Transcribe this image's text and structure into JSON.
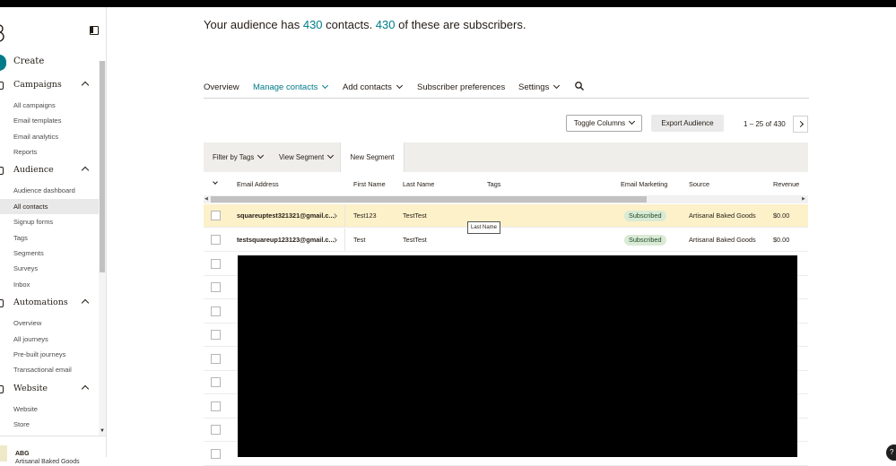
{
  "header": {
    "headline_prefix": "Your audience has ",
    "contacts_count": "430",
    "headline_middle": " contacts. ",
    "subscribers_count": "430",
    "headline_suffix": " of these are subscribers."
  },
  "sidebar": {
    "create_label": "Create",
    "sections": [
      {
        "label": "Campaigns",
        "items": [
          "All campaigns",
          "Email templates",
          "Email analytics",
          "Reports"
        ]
      },
      {
        "label": "Audience",
        "items": [
          "Audience dashboard",
          "All contacts",
          "Signup forms",
          "Tags",
          "Segments",
          "Surveys",
          "Inbox"
        ]
      },
      {
        "label": "Automations",
        "items": [
          "Overview",
          "All journeys",
          "Pre-built journeys",
          "Transactional email"
        ]
      },
      {
        "label": "Website",
        "items": [
          "Website",
          "Store"
        ]
      }
    ],
    "active_item": "All contacts",
    "account_initials": "ABG",
    "account_name": "Artisanal Baked Goods"
  },
  "nav": {
    "tabs": [
      "Overview",
      "Manage contacts",
      "Add contacts",
      "Subscriber preferences",
      "Settings"
    ],
    "active_tab": "Manage contacts"
  },
  "toolbar": {
    "toggle_columns": "Toggle Columns",
    "export_audience": "Export Audience",
    "pager_range": "1 – 25",
    "pager_of": " of 430"
  },
  "filters": {
    "filter_by_tags": "Filter by Tags",
    "view_segment": "View Segment",
    "new_segment": "New Segment"
  },
  "table": {
    "columns": [
      "Email Address",
      "First Name",
      "Last Name",
      "Tags",
      "Email Marketing",
      "Source",
      "Revenue"
    ],
    "rows": [
      {
        "email": "squareuptest321321@gmail.c...",
        "first": "Test123",
        "last": "TestTest",
        "tags": "",
        "status": "Subscribed",
        "source": "Artisanal Baked Goods",
        "revenue": "$0.00"
      },
      {
        "email": "testsquareup123123@gmail.c...",
        "first": "Test",
        "last": "TestTest",
        "tags": "",
        "status": "Subscribed",
        "source": "Artisanal Baked Goods",
        "revenue": "$0.00"
      }
    ],
    "tooltip": "Last Name"
  },
  "colors": {
    "accent": "#007c89",
    "highlight_row": "#fdf1c9",
    "badge_bg": "#d9ead5"
  }
}
